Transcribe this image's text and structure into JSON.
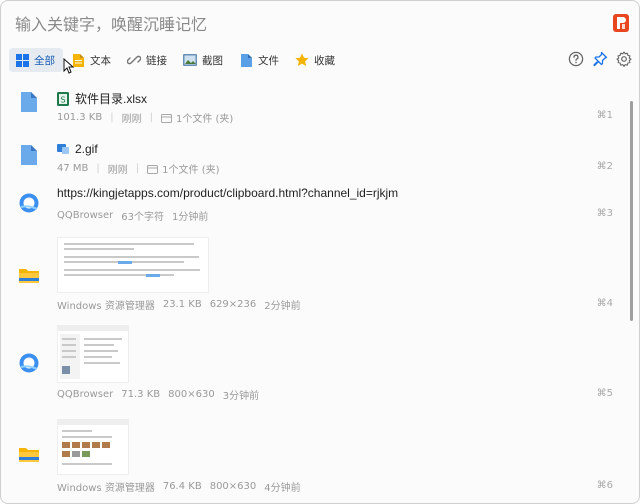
{
  "search": {
    "placeholder": "输入关键字，唤醒沉睡记忆"
  },
  "filters": [
    {
      "label": "全部",
      "icon": "grid-icon",
      "active": true
    },
    {
      "label": "文本",
      "icon": "text-icon",
      "active": false
    },
    {
      "label": "链接",
      "icon": "link-icon",
      "active": false
    },
    {
      "label": "截图",
      "icon": "screenshot-icon",
      "active": false
    },
    {
      "label": "文件",
      "icon": "file-icon",
      "active": false
    },
    {
      "label": "收藏",
      "icon": "star-icon",
      "active": false
    }
  ],
  "colors": {
    "accent": "#1a5fb4",
    "app_logo": "#e8461f"
  },
  "items": [
    {
      "title": "软件目录.xlsx",
      "type": "file",
      "meta": [
        "101.3 KB",
        "刚刚"
      ],
      "extra": "1个文件 (夹)",
      "key": "⌘1",
      "source_icon": "file-icon"
    },
    {
      "title": "2.gif",
      "type": "file",
      "meta": [
        "47 MB",
        "刚刚"
      ],
      "extra": "1个文件 (夹)",
      "key": "⌘2",
      "source_icon": "file-icon"
    },
    {
      "title": "https://kingjetapps.com/product/clipboard.html?channel_id=rjkjm",
      "type": "link",
      "meta": [
        "QQBrowser",
        "63个字符",
        "1分钟前"
      ],
      "key": "⌘3",
      "source_icon": "qqbrowser-icon"
    },
    {
      "type": "image",
      "meta": [
        "Windows 资源管理器",
        "23.1 KB",
        "629×236",
        "2分钟前"
      ],
      "key": "⌘4",
      "source_icon": "explorer-icon"
    },
    {
      "type": "image",
      "meta": [
        "QQBrowser",
        "71.3 KB",
        "800×630",
        "3分钟前"
      ],
      "key": "⌘5",
      "source_icon": "qqbrowser-icon"
    },
    {
      "type": "image",
      "meta": [
        "Windows 资源管理器",
        "76.4 KB",
        "800×630",
        "4分钟前"
      ],
      "key": "⌘6",
      "source_icon": "explorer-icon"
    }
  ]
}
